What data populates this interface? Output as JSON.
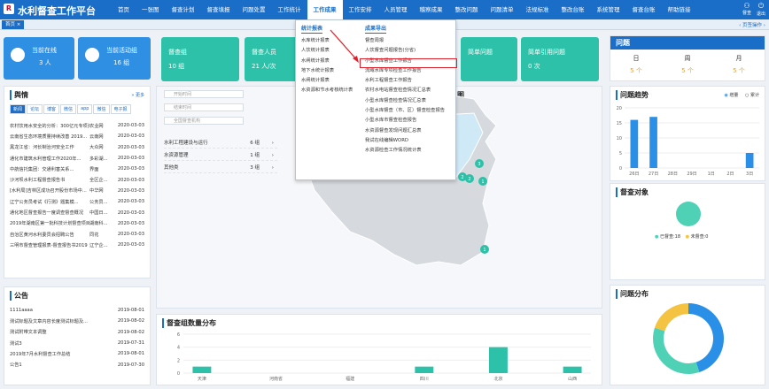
{
  "app": {
    "logo": "R",
    "title": "水利督查工作平台"
  },
  "nav": [
    "首页",
    "一张图",
    "督查计划",
    "督查填报",
    "问题处置",
    "工作统计",
    "工作成果",
    "工作安排",
    "人员管理",
    "稽察成果",
    "整改问题",
    "问题清单",
    "法规标准",
    "整改台账",
    "系统管理",
    "督查台账",
    "帮助链接"
  ],
  "user": {
    "u1": "督查",
    "u2": "退出"
  },
  "tabbar": {
    "home": "首页",
    "ops": "‹ 页签操作 ›"
  },
  "cards": [
    {
      "title": "当前在线",
      "value": "3 人",
      "color": "#2e8fe3"
    },
    {
      "title": "当前活动组",
      "value": "16 组",
      "color": "#2e8fe3"
    }
  ],
  "stats": [
    {
      "title": "督查组",
      "value": "10 组"
    },
    {
      "title": "督查人员",
      "value": "21 人/次"
    },
    {
      "title": "简单问题",
      "value": ""
    },
    {
      "title": "简单引用问题",
      "value": "0 次"
    }
  ],
  "news": {
    "title": "舆情",
    "more": "更多",
    "tabs": [
      "新闻",
      "论坛",
      "博客",
      "微信",
      "app",
      "微信",
      "电子报"
    ],
    "items": [
      {
        "title": "农村饮用水安全的分析：300亿元专项资金...",
        "src": "农业网",
        "date": "2020-03-03"
      },
      {
        "title": "云南省生态环境质量持续改善 2019...",
        "src": "云南网",
        "date": "2020-03-03"
      },
      {
        "title": "黑龙江省：河长制治河安全工作",
        "src": "大众网",
        "date": "2020-03-03"
      },
      {
        "title": "通化市建筑水利管理工作2020年...",
        "src": "多彩湖...",
        "date": "2020-03-03"
      },
      {
        "title": "中航信托集团：交通利害关系...",
        "src": "界面",
        "date": "2020-03-03"
      },
      {
        "title": "沙河坝水利工程督查报告书",
        "src": "全区企...",
        "date": "2020-03-03"
      },
      {
        "title": "[水利局]吉林区成功召开股份市场中...",
        "src": "中华网",
        "date": "2020-03-03"
      },
      {
        "title": "辽宁公务员考试《行测》题集模...",
        "src": "公务员...",
        "date": "2020-03-03"
      },
      {
        "title": "通化地区督查报告一度调查督查概况",
        "src": "中国日...",
        "date": "2020-03-03"
      },
      {
        "title": "2019年湖南区第一批科技计划督查项目...",
        "src": "湖南科...",
        "date": "2020-03-03"
      },
      {
        "title": "自治区黄河水利委员会招聘公告",
        "src": "同花",
        "date": "2020-03-03"
      },
      {
        "title": "三明市督查管理报表-督查报告书2019",
        "src": "辽宁企...",
        "date": "2020-03-03"
      }
    ]
  },
  "notice": {
    "title": "公告",
    "items": [
      {
        "title": "1111aaaa",
        "date": "2019-08-01"
      },
      {
        "title": "测试标题及文章内容长度测试标题及...",
        "date": "2019-08-02"
      },
      {
        "title": "测试附带文本调整",
        "date": "2019-08-02"
      },
      {
        "title": "测试3",
        "date": "2019-07-31"
      },
      {
        "title": "2019年7月水利督查工作总结",
        "date": "2019-08-01"
      },
      {
        "title": "公告1",
        "date": "2019-07-30"
      }
    ]
  },
  "filters": {
    "start": "开始时间",
    "end": "结束时间",
    "org": "全国督查机构"
  },
  "categories": [
    {
      "name": "水利工程建设与运行",
      "count": "6 组"
    },
    {
      "name": "水资源管理",
      "count": "1 组"
    },
    {
      "name": "其他类",
      "count": "3 组"
    }
  ],
  "map_title": "图",
  "map_markers": [
    "3",
    "2",
    "2",
    "1",
    "1"
  ],
  "dist_chart": {
    "title": "督查组数量分布",
    "chart_data": {
      "type": "bar",
      "categories": [
        "天津",
        "",
        "河南省",
        "",
        "福建",
        "",
        "四川",
        "",
        "北京",
        "",
        "山西"
      ],
      "values": [
        1,
        0,
        0,
        0,
        0,
        0,
        1,
        0,
        4,
        0,
        1
      ],
      "ylim": [
        0,
        6
      ],
      "yticks": [
        "6",
        "4",
        "2",
        "0"
      ]
    }
  },
  "menu": {
    "col1": {
      "head": "统计报表",
      "items": [
        "水库统计报表",
        "人饮统计报表",
        "水闸统计报表",
        "地下水统计报表",
        "水闸统计报表",
        "水资源和节水考核统计表"
      ]
    },
    "col2": {
      "head": "成果导出",
      "items": [
        "督查周报",
        "人饮督查问题报告(分省)",
        "小型水库督查工作报告",
        "流域水库专项检查工作报告",
        "水利工程督查工作报告",
        "农村水电站督查检查情况汇总表",
        "小型水库督查检查情况汇总表",
        "小型水库督查（市、区）督查检查报告",
        "小型水库市督查检查报告",
        "水资源督查发现问题汇总表",
        "我试在线编辑WORD",
        "水资源检查工作情况统计表"
      ]
    },
    "highlight_index": 2
  },
  "problems": {
    "title": "问题",
    "periods": [
      {
        "label": "日",
        "value": "5 个"
      },
      {
        "label": "周",
        "value": "5 个"
      },
      {
        "label": "月",
        "value": "5 个"
      }
    ]
  },
  "trend": {
    "title": "问题趋势",
    "legend": [
      "增量",
      "累计"
    ],
    "chart_data": {
      "type": "bar",
      "categories": [
        "26日",
        "27日",
        "28日",
        "29日",
        "1日",
        "2日",
        "3日"
      ],
      "values": [
        16,
        17,
        0,
        0,
        0,
        0,
        5
      ],
      "ylim": [
        0,
        20
      ],
      "yticks": [
        "20",
        "15",
        "10",
        "5",
        "0"
      ]
    }
  },
  "targets": {
    "title": "督查对象",
    "legend": [
      {
        "label": "已督查:18",
        "color": "#4fd1b5"
      },
      {
        "label": "未督查:0",
        "color": "#f5c342"
      }
    ]
  },
  "distribution": {
    "title": "问题分布",
    "chart_data": {
      "type": "pie",
      "values": [
        45,
        35,
        20
      ],
      "colors": [
        "#2a8fe6",
        "#4fd1b5",
        "#f5c342"
      ]
    }
  }
}
